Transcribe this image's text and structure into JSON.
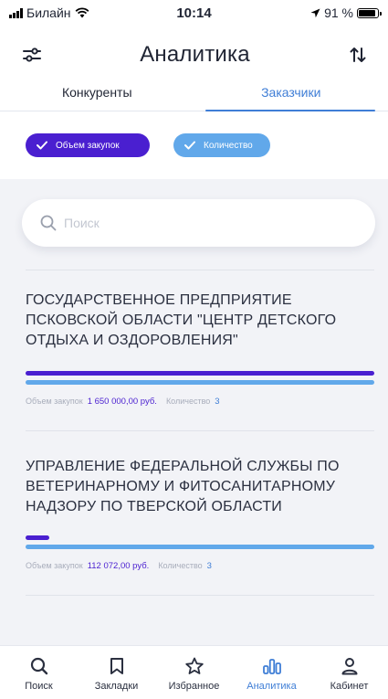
{
  "status_bar": {
    "carrier": "Билайн",
    "time": "10:14",
    "battery_percent": "91 %",
    "battery_level": 0.91
  },
  "header": {
    "title": "Аналитика",
    "filter_icon": "sliders-icon",
    "sort_icon": "sort-arrows-icon"
  },
  "tabs": [
    {
      "label": "Конкуренты",
      "active": false
    },
    {
      "label": "Заказчики",
      "active": true
    }
  ],
  "filters": [
    {
      "label": "Объем закупок",
      "checked": true,
      "color": "#4a1fd0"
    },
    {
      "label": "Количество",
      "checked": true,
      "color": "#61a8ea"
    }
  ],
  "search": {
    "placeholder": "Поиск"
  },
  "results": [
    {
      "title": "ГОСУДАРСТВЕННОЕ ПРЕДПРИЯТИЕ ПСКОВСКОЙ ОБЛАСТИ \"ЦЕНТР ДЕТСКОГО ОТДЫХА И ОЗДОРОВЛЕНИЯ\"",
      "volume_label": "Объем закупок",
      "volume_value": "1 650 000,00 руб.",
      "count_label": "Количество",
      "count_value": "3",
      "volume_fraction": 1.0,
      "count_fraction": 1.0
    },
    {
      "title": "УПРАВЛЕНИЕ ФЕДЕРАЛЬНОЙ СЛУЖБЫ ПО ВЕТЕРИНАРНОМУ И ФИТОСАНИТАРНОМУ НАДЗОРУ ПО ТВЕРСКОЙ ОБЛАСТИ",
      "volume_label": "Объем закупок",
      "volume_value": "112 072,00 руб.",
      "count_label": "Количество",
      "count_value": "3",
      "volume_fraction": 0.068,
      "count_fraction": 1.0
    }
  ],
  "bottom_nav": [
    {
      "label": "Поиск",
      "icon": "search-icon",
      "active": false
    },
    {
      "label": "Закладки",
      "icon": "bookmark-icon",
      "active": false
    },
    {
      "label": "Избранное",
      "icon": "star-icon",
      "active": false
    },
    {
      "label": "Аналитика",
      "icon": "analytics-icon",
      "active": true
    },
    {
      "label": "Кабинет",
      "icon": "user-icon",
      "active": false
    }
  ],
  "colors": {
    "accent_purple": "#4a1fd0",
    "accent_blue": "#61a8ea",
    "active_tab": "#3f7ed6"
  }
}
